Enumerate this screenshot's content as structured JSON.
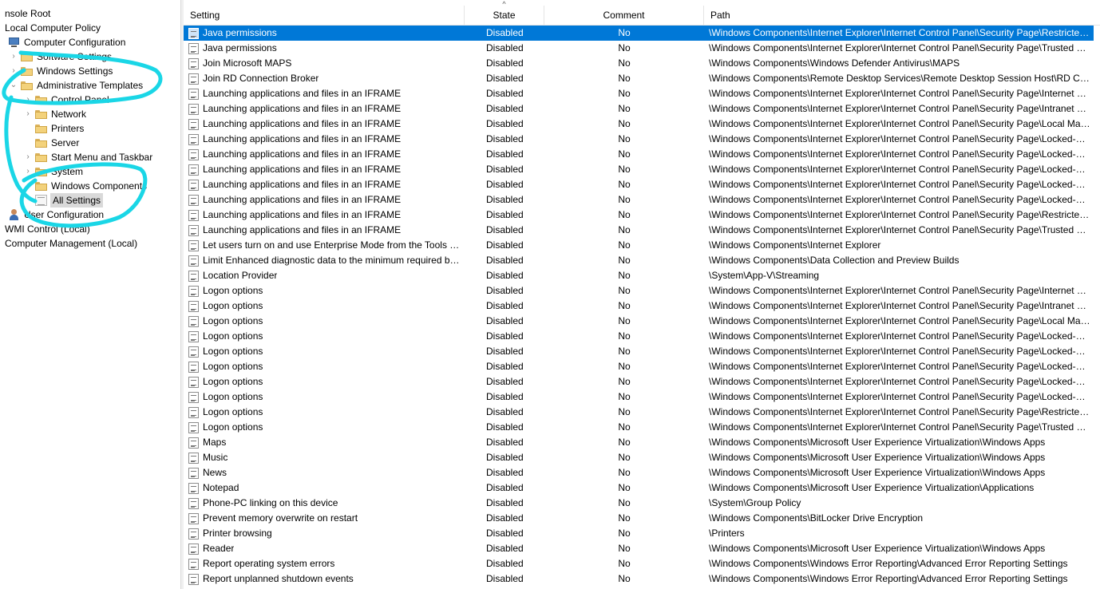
{
  "tree": [
    {
      "label": "nsole Root",
      "level": 0,
      "icon": "none",
      "expander": "none"
    },
    {
      "label": "Local Computer Policy",
      "level": 0,
      "icon": "none",
      "expander": "none"
    },
    {
      "label": "Computer Configuration",
      "level": 1,
      "icon": "pc-icon",
      "expander": "none"
    },
    {
      "label": "Software Settings",
      "level": 2,
      "icon": "folder-icon",
      "expander": "collapsed"
    },
    {
      "label": "Windows Settings",
      "level": 2,
      "icon": "folder-icon",
      "expander": "collapsed"
    },
    {
      "label": "Administrative Templates",
      "level": 2,
      "icon": "folder-icon",
      "expander": "expanded"
    },
    {
      "label": "Control Panel",
      "level": 3,
      "icon": "folder-icon",
      "expander": "collapsed"
    },
    {
      "label": "Network",
      "level": 3,
      "icon": "folder-icon",
      "expander": "collapsed"
    },
    {
      "label": "Printers",
      "level": 3,
      "icon": "folder-icon",
      "expander": "none"
    },
    {
      "label": "Server",
      "level": 3,
      "icon": "folder-icon",
      "expander": "none"
    },
    {
      "label": "Start Menu and Taskbar",
      "level": 3,
      "icon": "folder-icon",
      "expander": "collapsed"
    },
    {
      "label": "System",
      "level": 3,
      "icon": "folder-icon",
      "expander": "collapsed"
    },
    {
      "label": "Windows Components",
      "level": 3,
      "icon": "folder-icon",
      "expander": "collapsed"
    },
    {
      "label": "All Settings",
      "level": 3,
      "icon": "all-settings-icon",
      "expander": "none",
      "selected": true
    },
    {
      "label": "User Configuration",
      "level": 1,
      "icon": "user-icon",
      "expander": "collapsed"
    },
    {
      "label": "WMI Control (Local)",
      "level": 0,
      "icon": "none",
      "expander": "none"
    },
    {
      "label": "Computer Management (Local)",
      "level": 0,
      "icon": "none",
      "expander": "none"
    }
  ],
  "columns": {
    "setting": "Setting",
    "state": "State",
    "comment": "Comment",
    "path": "Path",
    "sort_indicator": "^"
  },
  "rows": [
    [
      "Java permissions",
      "Disabled",
      "No",
      "\\Windows Components\\Internet Explorer\\Internet Control Panel\\Security Page\\Restricted Sites Zone"
    ],
    [
      "Java permissions",
      "Disabled",
      "No",
      "\\Windows Components\\Internet Explorer\\Internet Control Panel\\Security Page\\Trusted Sites Zone"
    ],
    [
      "Join Microsoft MAPS",
      "Disabled",
      "No",
      "\\Windows Components\\Windows Defender Antivirus\\MAPS"
    ],
    [
      "Join RD Connection Broker",
      "Disabled",
      "No",
      "\\Windows Components\\Remote Desktop Services\\Remote Desktop Session Host\\RD Connection Broker"
    ],
    [
      "Launching applications and files in an IFRAME",
      "Disabled",
      "No",
      "\\Windows Components\\Internet Explorer\\Internet Control Panel\\Security Page\\Internet Zone"
    ],
    [
      "Launching applications and files in an IFRAME",
      "Disabled",
      "No",
      "\\Windows Components\\Internet Explorer\\Internet Control Panel\\Security Page\\Intranet Zone"
    ],
    [
      "Launching applications and files in an IFRAME",
      "Disabled",
      "No",
      "\\Windows Components\\Internet Explorer\\Internet Control Panel\\Security Page\\Local Machine Zone"
    ],
    [
      "Launching applications and files in an IFRAME",
      "Disabled",
      "No",
      "\\Windows Components\\Internet Explorer\\Internet Control Panel\\Security Page\\Locked-Down Internet Zone"
    ],
    [
      "Launching applications and files in an IFRAME",
      "Disabled",
      "No",
      "\\Windows Components\\Internet Explorer\\Internet Control Panel\\Security Page\\Locked-Down Intranet Zone"
    ],
    [
      "Launching applications and files in an IFRAME",
      "Disabled",
      "No",
      "\\Windows Components\\Internet Explorer\\Internet Control Panel\\Security Page\\Locked-Down Local Machine Zone"
    ],
    [
      "Launching applications and files in an IFRAME",
      "Disabled",
      "No",
      "\\Windows Components\\Internet Explorer\\Internet Control Panel\\Security Page\\Locked-Down Restricted Sites Zone"
    ],
    [
      "Launching applications and files in an IFRAME",
      "Disabled",
      "No",
      "\\Windows Components\\Internet Explorer\\Internet Control Panel\\Security Page\\Locked-Down Trusted Sites Zone"
    ],
    [
      "Launching applications and files in an IFRAME",
      "Disabled",
      "No",
      "\\Windows Components\\Internet Explorer\\Internet Control Panel\\Security Page\\Restricted Sites Zone"
    ],
    [
      "Launching applications and files in an IFRAME",
      "Disabled",
      "No",
      "\\Windows Components\\Internet Explorer\\Internet Control Panel\\Security Page\\Trusted Sites Zone"
    ],
    [
      "Let users turn on and use Enterprise Mode from the Tools menu",
      "Disabled",
      "No",
      "\\Windows Components\\Internet Explorer"
    ],
    [
      "Limit Enhanced diagnostic data to the minimum required by Windows Analytics",
      "Disabled",
      "No",
      "\\Windows Components\\Data Collection and Preview Builds"
    ],
    [
      "Location Provider",
      "Disabled",
      "No",
      "\\System\\App-V\\Streaming"
    ],
    [
      "Logon options",
      "Disabled",
      "No",
      "\\Windows Components\\Internet Explorer\\Internet Control Panel\\Security Page\\Internet Zone"
    ],
    [
      "Logon options",
      "Disabled",
      "No",
      "\\Windows Components\\Internet Explorer\\Internet Control Panel\\Security Page\\Intranet Zone"
    ],
    [
      "Logon options",
      "Disabled",
      "No",
      "\\Windows Components\\Internet Explorer\\Internet Control Panel\\Security Page\\Local Machine Zone"
    ],
    [
      "Logon options",
      "Disabled",
      "No",
      "\\Windows Components\\Internet Explorer\\Internet Control Panel\\Security Page\\Locked-Down Internet Zone"
    ],
    [
      "Logon options",
      "Disabled",
      "No",
      "\\Windows Components\\Internet Explorer\\Internet Control Panel\\Security Page\\Locked-Down Intranet Zone"
    ],
    [
      "Logon options",
      "Disabled",
      "No",
      "\\Windows Components\\Internet Explorer\\Internet Control Panel\\Security Page\\Locked-Down Local Machine Zone"
    ],
    [
      "Logon options",
      "Disabled",
      "No",
      "\\Windows Components\\Internet Explorer\\Internet Control Panel\\Security Page\\Locked-Down Restricted Sites Zone"
    ],
    [
      "Logon options",
      "Disabled",
      "No",
      "\\Windows Components\\Internet Explorer\\Internet Control Panel\\Security Page\\Locked-Down Trusted Sites Zone"
    ],
    [
      "Logon options",
      "Disabled",
      "No",
      "\\Windows Components\\Internet Explorer\\Internet Control Panel\\Security Page\\Restricted Sites Zone"
    ],
    [
      "Logon options",
      "Disabled",
      "No",
      "\\Windows Components\\Internet Explorer\\Internet Control Panel\\Security Page\\Trusted Sites Zone"
    ],
    [
      "Maps",
      "Disabled",
      "No",
      "\\Windows Components\\Microsoft User Experience Virtualization\\Windows Apps"
    ],
    [
      "Music",
      "Disabled",
      "No",
      "\\Windows Components\\Microsoft User Experience Virtualization\\Windows Apps"
    ],
    [
      "News",
      "Disabled",
      "No",
      "\\Windows Components\\Microsoft User Experience Virtualization\\Windows Apps"
    ],
    [
      "Notepad",
      "Disabled",
      "No",
      "\\Windows Components\\Microsoft User Experience Virtualization\\Applications"
    ],
    [
      "Phone-PC linking on this device",
      "Disabled",
      "No",
      "\\System\\Group Policy"
    ],
    [
      "Prevent memory overwrite on restart",
      "Disabled",
      "No",
      "\\Windows Components\\BitLocker Drive Encryption"
    ],
    [
      "Printer browsing",
      "Disabled",
      "No",
      "\\Printers"
    ],
    [
      "Reader",
      "Disabled",
      "No",
      "\\Windows Components\\Microsoft User Experience Virtualization\\Windows Apps"
    ],
    [
      "Report operating system errors",
      "Disabled",
      "No",
      "\\Windows Components\\Windows Error Reporting\\Advanced Error Reporting Settings"
    ],
    [
      "Report unplanned shutdown events",
      "Disabled",
      "No",
      "\\Windows Components\\Windows Error Reporting\\Advanced Error Reporting Settings"
    ]
  ],
  "selected_row": 0,
  "colors": {
    "selection": "#0078d7",
    "annotation": "#1ad6e6",
    "tree_selected": "#d9d9d9"
  }
}
